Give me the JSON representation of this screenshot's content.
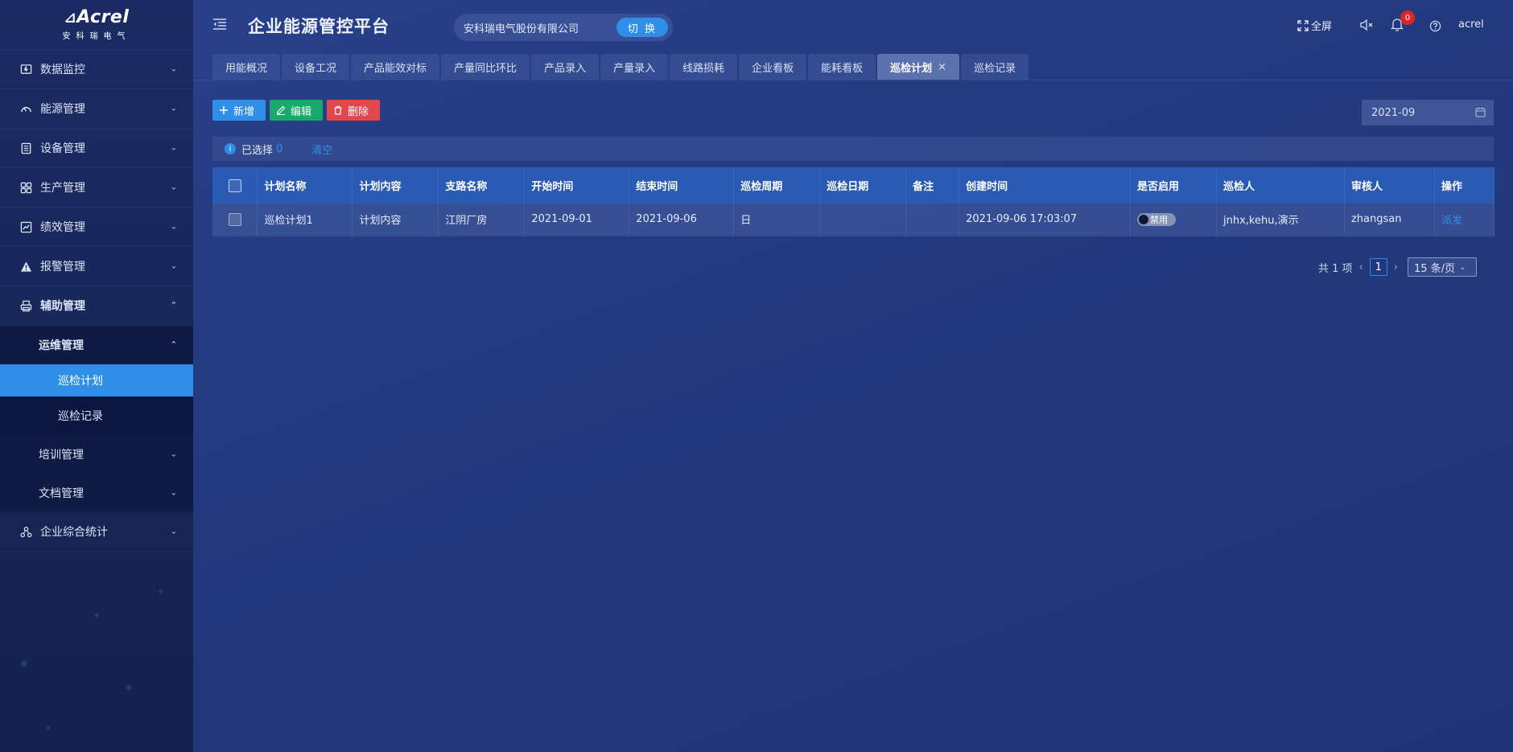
{
  "logo": {
    "brand": "Acrel",
    "sub": "安科瑞电气"
  },
  "sidebar": {
    "items": [
      {
        "label": "数据监控",
        "icon": "monitor-icon"
      },
      {
        "label": "能源管理",
        "icon": "gauge-icon"
      },
      {
        "label": "设备管理",
        "icon": "list-icon"
      },
      {
        "label": "生产管理",
        "icon": "grid-icon"
      },
      {
        "label": "绩效管理",
        "icon": "chart-icon"
      },
      {
        "label": "报警管理",
        "icon": "warning-icon"
      },
      {
        "label": "辅助管理",
        "icon": "printer-icon"
      },
      {
        "label": "企业综合统计",
        "icon": "nodes-icon"
      }
    ],
    "sub": {
      "ops": "运维管理",
      "plan": "巡检计划",
      "record": "巡检记录",
      "training": "培训管理",
      "docs": "文档管理"
    }
  },
  "header": {
    "title": "企业能源管控平台",
    "company": "安科瑞电气股份有限公司",
    "switch": "切 换",
    "fullscreen": "全屏",
    "badge": "0",
    "user": "acrel"
  },
  "tabs": [
    "用能概况",
    "设备工况",
    "产品能效对标",
    "产量同比环比",
    "产品录入",
    "产量录入",
    "线路损耗",
    "企业看板",
    "能耗看板",
    "巡检计划",
    "巡检记录"
  ],
  "active_tab_close": "×",
  "toolbar": {
    "add": "新增",
    "edit": "编辑",
    "delete": "删除"
  },
  "date": "2021-09",
  "selection": {
    "label": "已选择",
    "count": "0",
    "clear": "清空",
    "info": "i"
  },
  "table": {
    "columns": [
      "计划名称",
      "计划内容",
      "支路名称",
      "开始时间",
      "结束时间",
      "巡检周期",
      "巡检日期",
      "备注",
      "创建时间",
      "是否启用",
      "巡检人",
      "审核人",
      "操作"
    ],
    "rows": [
      [
        "巡检计划1",
        "计划内容",
        "江阴厂房",
        "2021-09-01",
        "2021-09-06",
        "日",
        "",
        "",
        "2021-09-06 17:03:07",
        "禁用",
        "jnhx,kehu,演示",
        "zhangsan",
        "派发"
      ]
    ]
  },
  "pager": {
    "total": "共 1 项",
    "page": "1",
    "size": "15 条/页",
    "prev": "‹",
    "next": "›"
  },
  "colors": {
    "accent": "#2f8fe8",
    "add": "#2f8fe8",
    "edit": "#1aa86b",
    "delete": "#e0474f",
    "header_bg": "#2a5bb4"
  }
}
